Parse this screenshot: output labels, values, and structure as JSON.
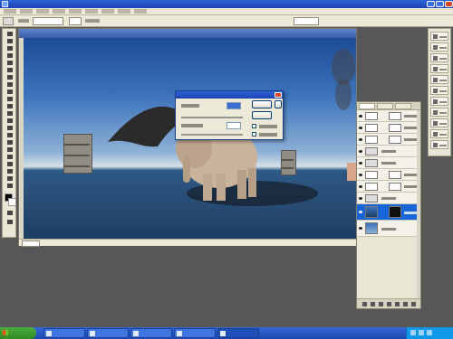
{
  "window": {
    "title": ""
  },
  "document": {
    "title": "",
    "zoom": ""
  },
  "dialog": {
    "title": "",
    "field1_label": "",
    "field1_value": "",
    "field2_label": "",
    "field2_value": "",
    "ok_label": "",
    "cancel_label": "",
    "load_label": "",
    "option1_label": "",
    "option2_label": ""
  },
  "layers": {
    "tabs": [
      "",
      "",
      ""
    ],
    "rows": [
      "",
      "",
      "",
      "",
      "",
      "",
      "",
      "",
      "",
      ""
    ]
  },
  "taskbar": {
    "start_label": "",
    "tasks": [
      "",
      "",
      "",
      "",
      ""
    ],
    "clock": ""
  },
  "colors": {
    "titlebar": "#1c45b3",
    "taskbar": "#3168d5",
    "selection": "#1765d6",
    "sky": "#3a72ba",
    "sea": "#2a4f78"
  }
}
